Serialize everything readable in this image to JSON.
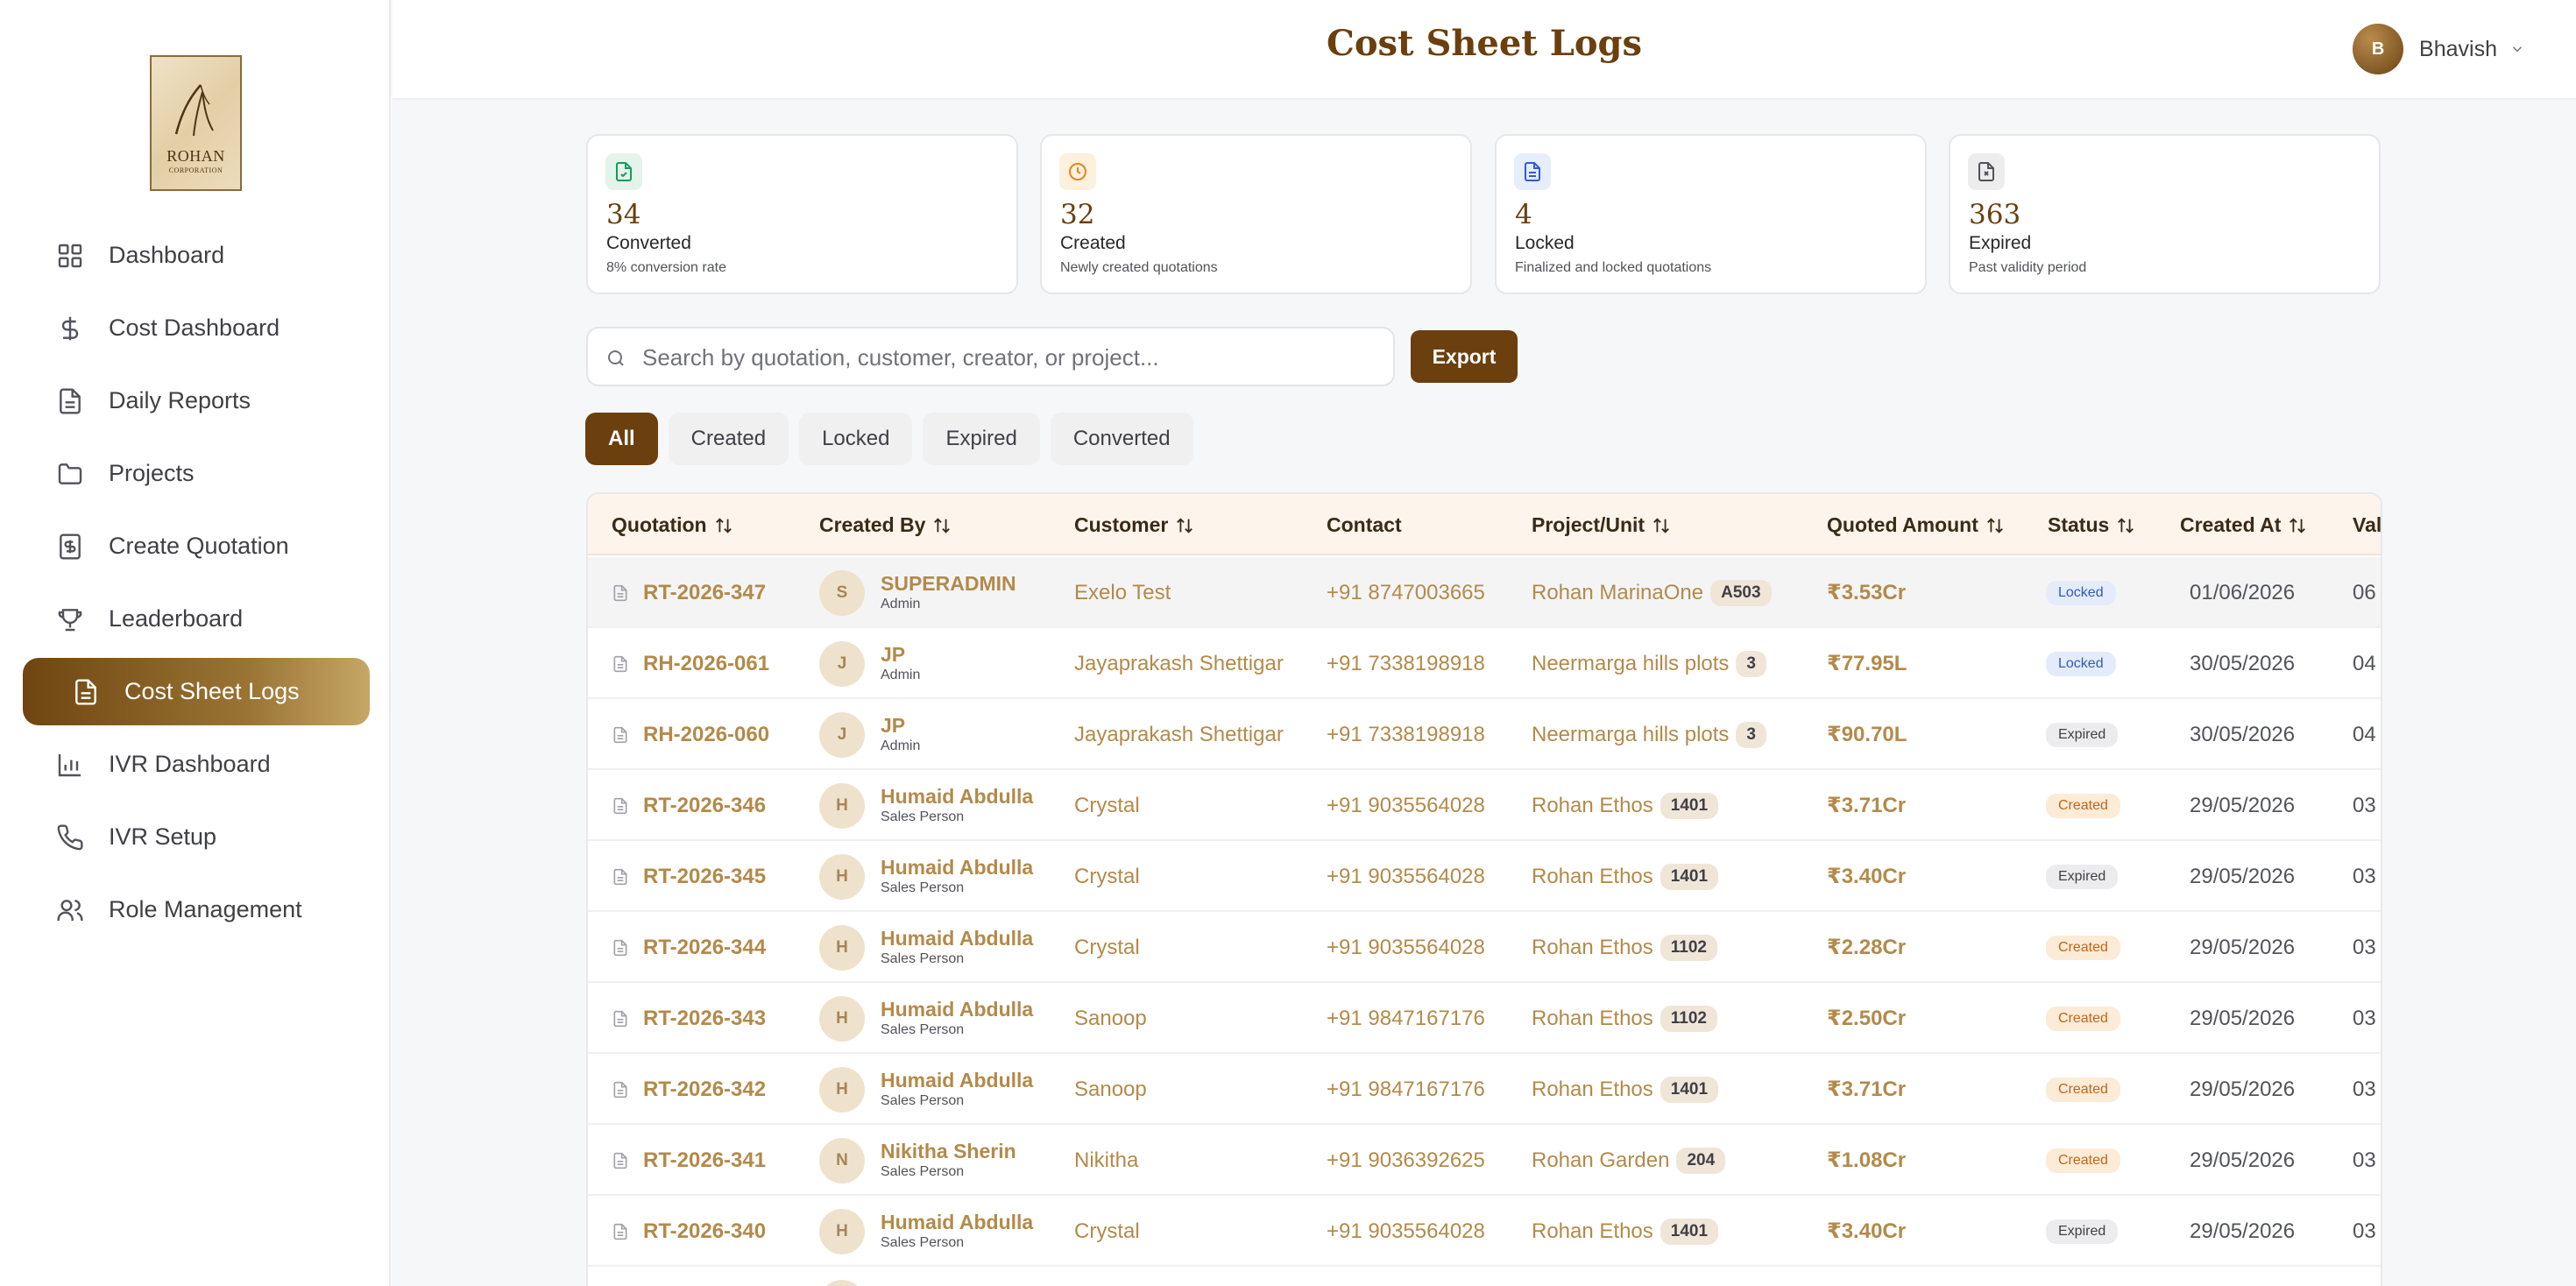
{
  "logo": {
    "title": "ROHAN",
    "subtitle": "CORPORATION"
  },
  "sidebar": {
    "items": [
      {
        "label": "Dashboard",
        "icon": "grid-icon"
      },
      {
        "label": "Cost Dashboard",
        "icon": "dollar-icon"
      },
      {
        "label": "Daily Reports",
        "icon": "document-icon"
      },
      {
        "label": "Projects",
        "icon": "folder-icon"
      },
      {
        "label": "Create Quotation",
        "icon": "receipt-icon"
      },
      {
        "label": "Leaderboard",
        "icon": "trophy-icon"
      },
      {
        "label": "Cost Sheet Logs",
        "icon": "document-icon",
        "active": true
      },
      {
        "label": "IVR Dashboard",
        "icon": "bar-chart-icon"
      },
      {
        "label": "IVR Setup",
        "icon": "phone-icon"
      },
      {
        "label": "Role Management",
        "icon": "users-icon"
      }
    ]
  },
  "header": {
    "title": "Cost Sheet Logs",
    "user": {
      "initial": "B",
      "name": "Bhavish"
    }
  },
  "stats": [
    {
      "value": "34",
      "label": "Converted",
      "sub": "8% conversion rate",
      "icon": "file-check-icon",
      "color": "#1a9a5b",
      "bg": "#e3f4ea"
    },
    {
      "value": "32",
      "label": "Created",
      "sub": "Newly created quotations",
      "icon": "clock-icon",
      "color": "#e2851c",
      "bg": "#fdf0dd"
    },
    {
      "value": "4",
      "label": "Locked",
      "sub": "Finalized and locked quotations",
      "icon": "file-text-icon",
      "color": "#2f5bd9",
      "bg": "#e6edfb"
    },
    {
      "value": "363",
      "label": "Expired",
      "sub": "Past validity period",
      "icon": "file-x-icon",
      "color": "#52525b",
      "bg": "#ededee"
    }
  ],
  "search": {
    "placeholder": "Search by quotation, customer, creator, or project...",
    "value": ""
  },
  "export_label": "Export",
  "filters": [
    {
      "label": "All",
      "active": true
    },
    {
      "label": "Created"
    },
    {
      "label": "Locked"
    },
    {
      "label": "Expired"
    },
    {
      "label": "Converted"
    }
  ],
  "table": {
    "columns": [
      "Quotation",
      "Created By",
      "Customer",
      "Contact",
      "Project/Unit",
      "Quoted Amount",
      "Status",
      "Created At",
      "Val"
    ],
    "rows": [
      {
        "id": "RT-2026-347",
        "initial": "S",
        "creator": "SUPERADMIN",
        "role": "Admin",
        "customer": "Exelo Test",
        "contact": "+91 8747003665",
        "project": "Rohan MarinaOne",
        "unit": "A503",
        "amount": "₹3.53Cr",
        "status": "Locked",
        "created": "01/06/2026",
        "valid": "06"
      },
      {
        "id": "RH-2026-061",
        "initial": "J",
        "creator": "JP",
        "role": "Admin",
        "customer": "Jayaprakash Shettigar",
        "contact": "+91 7338198918",
        "project": "Neermarga hills plots",
        "unit": "3",
        "amount": "₹77.95L",
        "status": "Locked",
        "created": "30/05/2026",
        "valid": "04"
      },
      {
        "id": "RH-2026-060",
        "initial": "J",
        "creator": "JP",
        "role": "Admin",
        "customer": "Jayaprakash Shettigar",
        "contact": "+91 7338198918",
        "project": "Neermarga hills plots",
        "unit": "3",
        "amount": "₹90.70L",
        "status": "Expired",
        "created": "30/05/2026",
        "valid": "04"
      },
      {
        "id": "RT-2026-346",
        "initial": "H",
        "creator": "Humaid Abdulla",
        "role": "Sales Person",
        "customer": "Crystal",
        "contact": "+91 9035564028",
        "project": "Rohan Ethos",
        "unit": "1401",
        "amount": "₹3.71Cr",
        "status": "Created",
        "created": "29/05/2026",
        "valid": "03"
      },
      {
        "id": "RT-2026-345",
        "initial": "H",
        "creator": "Humaid Abdulla",
        "role": "Sales Person",
        "customer": "Crystal",
        "contact": "+91 9035564028",
        "project": "Rohan Ethos",
        "unit": "1401",
        "amount": "₹3.40Cr",
        "status": "Expired",
        "created": "29/05/2026",
        "valid": "03"
      },
      {
        "id": "RT-2026-344",
        "initial": "H",
        "creator": "Humaid Abdulla",
        "role": "Sales Person",
        "customer": "Crystal",
        "contact": "+91 9035564028",
        "project": "Rohan Ethos",
        "unit": "1102",
        "amount": "₹2.28Cr",
        "status": "Created",
        "created": "29/05/2026",
        "valid": "03"
      },
      {
        "id": "RT-2026-343",
        "initial": "H",
        "creator": "Humaid Abdulla",
        "role": "Sales Person",
        "customer": "Sanoop",
        "contact": "+91 9847167176",
        "project": "Rohan Ethos",
        "unit": "1102",
        "amount": "₹2.50Cr",
        "status": "Created",
        "created": "29/05/2026",
        "valid": "03"
      },
      {
        "id": "RT-2026-342",
        "initial": "H",
        "creator": "Humaid Abdulla",
        "role": "Sales Person",
        "customer": "Sanoop",
        "contact": "+91 9847167176",
        "project": "Rohan Ethos",
        "unit": "1401",
        "amount": "₹3.71Cr",
        "status": "Created",
        "created": "29/05/2026",
        "valid": "03"
      },
      {
        "id": "RT-2026-341",
        "initial": "N",
        "creator": "Nikitha Sherin",
        "role": "Sales Person",
        "customer": "Nikitha",
        "contact": "+91 9036392625",
        "project": "Rohan Garden",
        "unit": "204",
        "amount": "₹1.08Cr",
        "status": "Created",
        "created": "29/05/2026",
        "valid": "03"
      },
      {
        "id": "RT-2026-340",
        "initial": "H",
        "creator": "Humaid Abdulla",
        "role": "Sales Person",
        "customer": "Crystal",
        "contact": "+91 9035564028",
        "project": "Rohan Ethos",
        "unit": "1401",
        "amount": "₹3.40Cr",
        "status": "Expired",
        "created": "29/05/2026",
        "valid": "03"
      }
    ]
  }
}
